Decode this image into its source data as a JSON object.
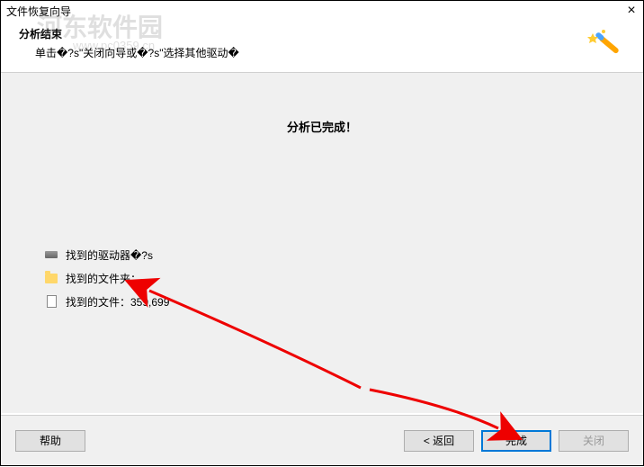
{
  "titlebar": {
    "title": "文件恢复向导"
  },
  "header": {
    "title": "分析结束",
    "subtitle": "单击�?s\"关闭向导或�?s\"选择其他驱动�"
  },
  "content": {
    "done": "分析已完成！"
  },
  "results": {
    "drivers": "找到的驱动器�?s",
    "folders": "找到的文件夹：",
    "files": "找到的文件：359,699"
  },
  "footer": {
    "help": "帮助",
    "back": "< 返回",
    "finish": "完成",
    "close": "关闭"
  },
  "watermark": {
    "text": "河东软件园",
    "url": "www.pc0359.cn"
  }
}
